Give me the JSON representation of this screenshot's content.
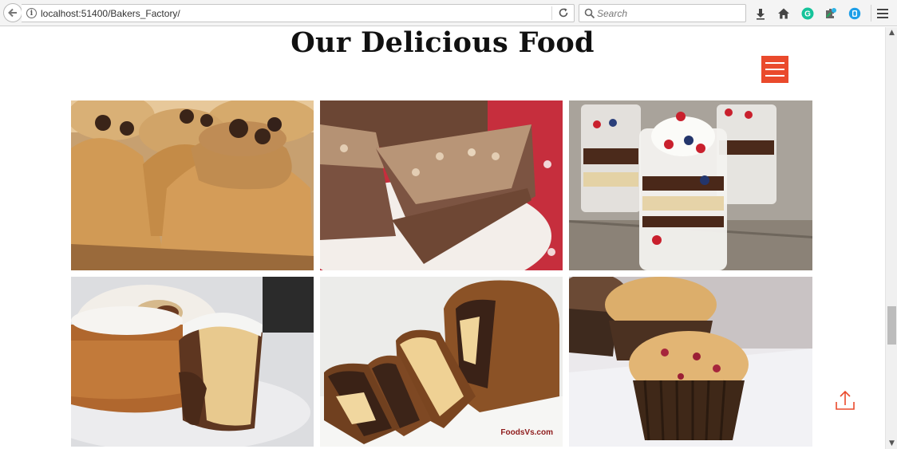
{
  "browser": {
    "url_host": "localhost:",
    "url_path": "51400/Bakers_Factory/",
    "search_placeholder": "Search",
    "icons": [
      "back-icon",
      "info-icon",
      "reload-icon",
      "search-icon",
      "download-icon",
      "home-icon",
      "grammarly-icon",
      "extension-icon",
      "skype-icon",
      "hamburger-menu-icon"
    ]
  },
  "page": {
    "title": "Our Delicious Food",
    "accent_color": "#ea4a2c",
    "gallery": [
      {
        "name": "peanut-butter-cookie-cupcakes"
      },
      {
        "name": "chocolate-hazelnut-tart"
      },
      {
        "name": "berry-trifle-cups"
      },
      {
        "name": "marble-bundt-cake"
      },
      {
        "name": "marble-loaf-cake",
        "watermark": "FoodsVs.com"
      },
      {
        "name": "berry-muffins"
      }
    ]
  }
}
